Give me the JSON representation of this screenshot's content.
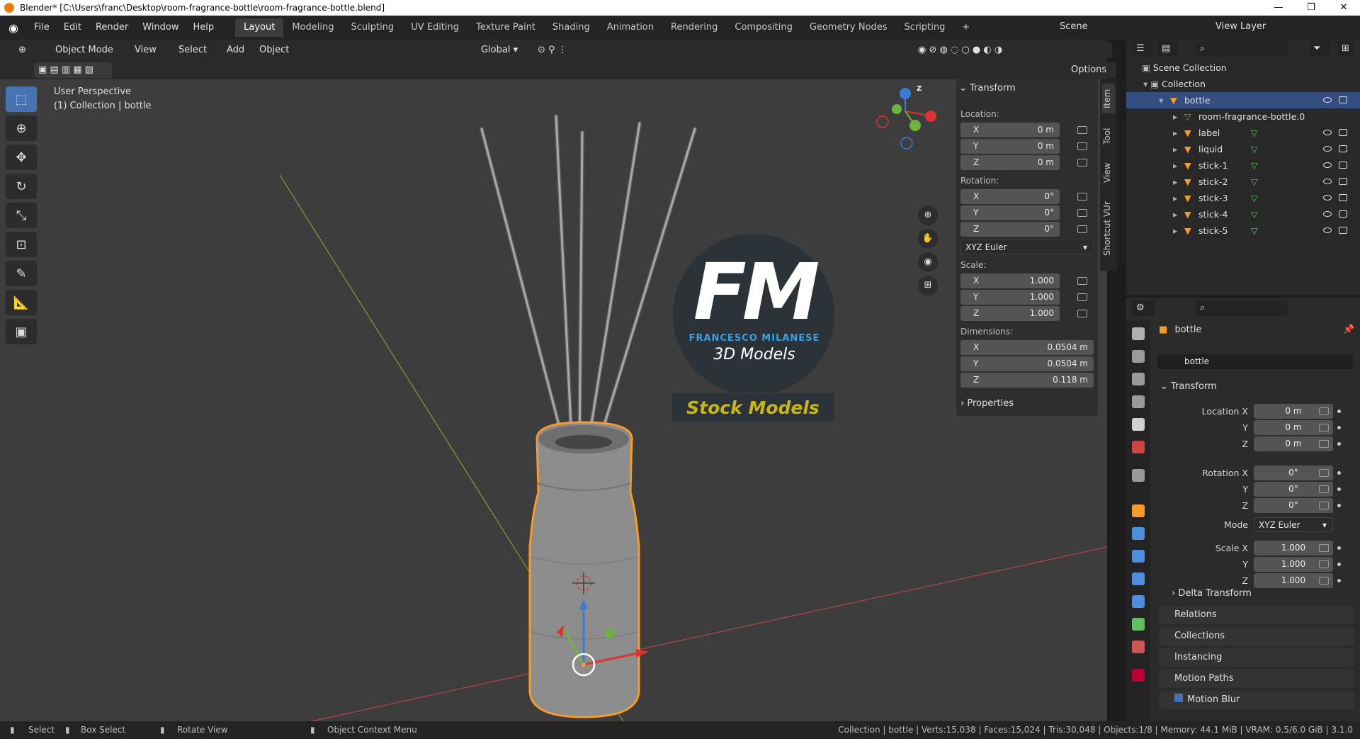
{
  "window": {
    "title": "Blender* [C:\\Users\\franc\\Desktop\\room-fragrance-bottle\\room-fragrance-bottle.blend]"
  },
  "menu": [
    "File",
    "Edit",
    "Render",
    "Window",
    "Help"
  ],
  "workspaces": [
    "Layout",
    "Modeling",
    "Sculpting",
    "UV Editing",
    "Texture Paint",
    "Shading",
    "Animation",
    "Rendering",
    "Compositing",
    "Geometry Nodes",
    "Scripting",
    "+"
  ],
  "scene": {
    "label": "Scene",
    "view_layer": "View Layer"
  },
  "header": {
    "mode": "Object Mode",
    "view": "View",
    "select": "Select",
    "add": "Add",
    "object": "Object",
    "orientation": "Global",
    "options": "Options"
  },
  "viewport": {
    "perspective": "User Perspective",
    "collection": "(1) Collection | bottle"
  },
  "overlay": {
    "initials": "FM",
    "brand": "FRANCESCO MILANESE",
    "models": "3D Models",
    "stock": "Stock Models"
  },
  "npanel": {
    "title": "Transform",
    "location_label": "Location:",
    "rotation_label": "Rotation:",
    "scale_label": "Scale:",
    "dimensions_label": "Dimensions:",
    "loc": [
      {
        "k": "X",
        "v": "0 m"
      },
      {
        "k": "Y",
        "v": "0 m"
      },
      {
        "k": "Z",
        "v": "0 m"
      }
    ],
    "rot": [
      {
        "k": "X",
        "v": "0°"
      },
      {
        "k": "Y",
        "v": "0°"
      },
      {
        "k": "Z",
        "v": "0°"
      }
    ],
    "rot_mode": "XYZ Euler",
    "scale": [
      {
        "k": "X",
        "v": "1.000"
      },
      {
        "k": "Y",
        "v": "1.000"
      },
      {
        "k": "Z",
        "v": "1.000"
      }
    ],
    "dim": [
      {
        "k": "X",
        "v": "0.0504 m"
      },
      {
        "k": "Y",
        "v": "0.0504 m"
      },
      {
        "k": "Z",
        "v": "0.118 m"
      }
    ],
    "properties": "Properties",
    "tabs": [
      "Item",
      "Tool",
      "View",
      "Shortcut VUr"
    ]
  },
  "outliner": {
    "scene_collection": "Scene Collection",
    "collection": "Collection",
    "items": [
      {
        "name": "bottle",
        "level": 2,
        "selected": true
      },
      {
        "name": "room-fragrance-bottle.0",
        "level": 3,
        "selected": false
      },
      {
        "name": "label",
        "level": 3,
        "selected": false
      },
      {
        "name": "liquid",
        "level": 3,
        "selected": false
      },
      {
        "name": "stick-1",
        "level": 3,
        "selected": false
      },
      {
        "name": "stick-2",
        "level": 3,
        "selected": false
      },
      {
        "name": "stick-3",
        "level": 3,
        "selected": false
      },
      {
        "name": "stick-4",
        "level": 3,
        "selected": false
      },
      {
        "name": "stick-5",
        "level": 3,
        "selected": false
      }
    ]
  },
  "properties": {
    "object_name": "bottle",
    "data_name": "bottle",
    "transform": "Transform",
    "loc": [
      {
        "k": "Location X",
        "v": "0 m"
      },
      {
        "k": "Y",
        "v": "0 m"
      },
      {
        "k": "Z",
        "v": "0 m"
      }
    ],
    "rot": [
      {
        "k": "Rotation X",
        "v": "0°"
      },
      {
        "k": "Y",
        "v": "0°"
      },
      {
        "k": "Z",
        "v": "0°"
      }
    ],
    "mode_label": "Mode",
    "mode": "XYZ Euler",
    "scale": [
      {
        "k": "Scale X",
        "v": "1.000"
      },
      {
        "k": "Y",
        "v": "1.000"
      },
      {
        "k": "Z",
        "v": "1.000"
      }
    ],
    "delta": "Delta Transform",
    "sections": [
      "Relations",
      "Collections",
      "Instancing",
      "Motion Paths",
      "Motion Blur"
    ]
  },
  "status": {
    "select": "Select",
    "box_select": "Box Select",
    "rotate": "Rotate View",
    "context": "Object Context Menu",
    "stats": "Collection | bottle | Verts:15,038 | Faces:15,024 | Tris:30,048 | Objects:1/8 | Memory: 44.1 MiB | VRAM: 0.5/6.0 GiB | 3.1.0"
  },
  "colors": {
    "accent": "#4772b3",
    "selection": "#f59b2f",
    "grid_x": "#d4444f",
    "grid_y": "#8bc34a"
  }
}
